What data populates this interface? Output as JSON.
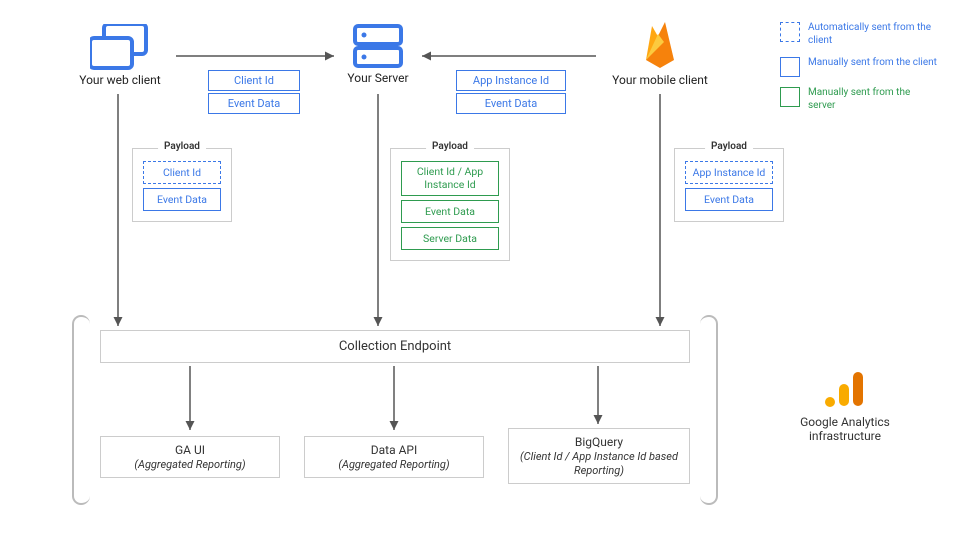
{
  "nodes": {
    "web_client": "Your web client",
    "server": "Your Server",
    "mobile_client": "Your mobile client"
  },
  "send_web": {
    "a": "Client Id",
    "b": "Event Data"
  },
  "send_mobile": {
    "a": "App Instance Id",
    "b": "Event Data"
  },
  "payload_label": "Payload",
  "payload_web": {
    "a": "Client Id",
    "b": "Event Data"
  },
  "payload_server": {
    "a": "Client Id / App Instance Id",
    "b": "Event Data",
    "c": "Server Data"
  },
  "payload_mobile": {
    "a": "App Instance Id",
    "b": "Event Data"
  },
  "collection": "Collection Endpoint",
  "results": {
    "ga": {
      "t": "GA UI",
      "s": "(Aggregated Reporting)"
    },
    "api": {
      "t": "Data API",
      "s": "(Aggregated Reporting)"
    },
    "bq": {
      "t": "BigQuery",
      "s": "(Client Id / App Instance Id based Reporting)"
    }
  },
  "ga_infra": "Google Analytics infrastructure",
  "legend": {
    "auto": "Automatically sent from the client",
    "client": "Manually sent from the client",
    "server": "Manually sent from the server"
  }
}
